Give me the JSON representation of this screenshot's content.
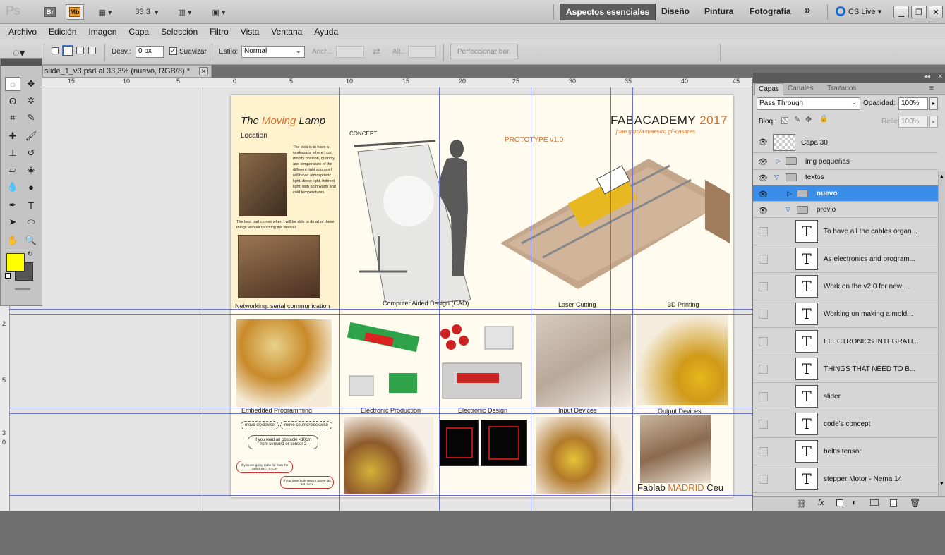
{
  "appbar": {
    "app_logo": "Ps",
    "bridge": "Br",
    "minibridge": "Mb",
    "zoom": "33,3",
    "workspaces": [
      "Aspectos esenciales",
      "Diseño",
      "Pintura",
      "Fotografía"
    ],
    "more": "»",
    "cslive": "CS Live"
  },
  "menu": [
    "Archivo",
    "Edición",
    "Imagen",
    "Capa",
    "Selección",
    "Filtro",
    "Vista",
    "Ventana",
    "Ayuda"
  ],
  "options": {
    "feather_label": "Desv.:",
    "feather_value": "0 px",
    "antialias_label": "Suavizar",
    "style_label": "Estilo:",
    "style_value": "Normal",
    "width_label": "Anch.:",
    "height_label": "Alt.:",
    "refine_label": "Perfeccionar bor."
  },
  "document": {
    "tab_title": "slide_1_v3.psd al 33,3% (nuevo, RGB/8) *"
  },
  "rulers": {
    "h_numbers": [
      "15",
      "10",
      "5",
      "0",
      "5",
      "10",
      "15",
      "20",
      "25",
      "30",
      "35",
      "40",
      "45"
    ],
    "v_numbers": [
      "2",
      "5",
      "3",
      "0"
    ]
  },
  "slide": {
    "title_moving": "The ",
    "title_moving_accent": "Moving",
    "title_lamp": " Lamp",
    "location": "Location",
    "idea_text": "The idea is to have a workspace where I can modify position, quantity and temperature of the different light sources I will have: atmospheric light, direct light, indirect light; with both warm and cold temperatures.",
    "best_part": "The best part comes when I will be able to do all of these things without touching the device!",
    "networking": "Networking: serial communication",
    "concept": "CONCEPT",
    "cad": "Computer Aided Design (CAD)",
    "prototype": "PROTOTYPE v1.0",
    "fabacademy": "FABACADEMY",
    "year": "2017",
    "author": "juan garcía-maestro gil-casares",
    "laser": "Laser Cutting",
    "printing": "3D Printing",
    "embedded": "Embedded Programming",
    "electronic_production": "Electronic Production",
    "electronic_design": "Electronic Design",
    "input_devices": "Input Devices",
    "output_devices": "Output Devices",
    "flow_clockwise": "move clockwise",
    "flow_counter": "move counterclockwise",
    "flow_obstacle": "If you read an obstacle <10cm from sensor1 or sensor 2",
    "flow_far": "If you are going to be far from the axis limits - STOP",
    "flow_both": "If you have both sensor active: do not move",
    "footer_fablab": "Fablab ",
    "footer_madrid": "MADRID",
    "footer_ceu": " Ceu"
  },
  "layers_panel": {
    "tabs": [
      "Capas",
      "Canales",
      "Trazados"
    ],
    "blend_mode": "Pass Through",
    "opacity_label": "Opacidad:",
    "opacity_value": "100%",
    "lock_label": "Bloq.:",
    "fill_label": "Relleno:",
    "fill_value": "100%",
    "layers": [
      {
        "name": "Capa 30",
        "kind": "pixel",
        "visible": true
      },
      {
        "name": "img pequeñas",
        "kind": "group",
        "visible": true
      },
      {
        "name": "textos",
        "kind": "group-open",
        "visible": true
      },
      {
        "name": "nuevo",
        "kind": "group",
        "visible": true,
        "selected": true
      },
      {
        "name": "previo",
        "kind": "group-open",
        "visible": true
      },
      {
        "name": "To have all the cables organ...",
        "kind": "text",
        "visible": false
      },
      {
        "name": "As electronics and program...",
        "kind": "text",
        "visible": false
      },
      {
        "name": "Work on the v2.0 for new ...",
        "kind": "text",
        "visible": false
      },
      {
        "name": "Working on making a mold...",
        "kind": "text",
        "visible": false
      },
      {
        "name": "ELECTRONICS INTEGRATI...",
        "kind": "text",
        "visible": false
      },
      {
        "name": "THINGS THAT NEED TO B...",
        "kind": "text",
        "visible": false
      },
      {
        "name": "slider",
        "kind": "text",
        "visible": false
      },
      {
        "name": "code's concept",
        "kind": "text",
        "visible": false
      },
      {
        "name": "belt's tensor",
        "kind": "text",
        "visible": false
      },
      {
        "name": "stepper Motor - Nema 14",
        "kind": "text",
        "visible": false
      }
    ]
  },
  "colors": {
    "accent_orange": "#d9702a",
    "selected_layer": "#3a8ee8",
    "foreground": "#ffff00",
    "background": "#555555",
    "guide": "#6d73d8"
  }
}
